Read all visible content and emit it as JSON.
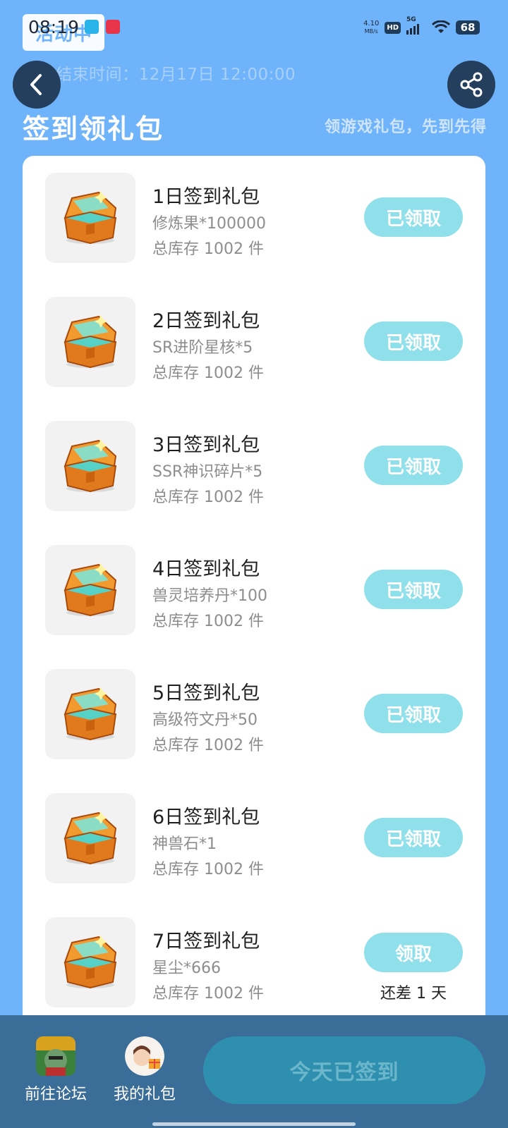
{
  "status_bar": {
    "time": "08:19",
    "net_speed_value": "4.10",
    "net_speed_unit": "MB/s",
    "hd": "HD",
    "signal": "5G",
    "battery": "68"
  },
  "header": {
    "status_chip": "活动中",
    "end_time": "活动结束时间：12月17日 12:00:00",
    "title": "签到领礼包",
    "subtitle": "领游戏礼包，先到先得"
  },
  "gifts": [
    {
      "name": "1日签到礼包",
      "item": "修炼果*100000",
      "stock": "总库存 1002 件",
      "button": "已领取",
      "note": ""
    },
    {
      "name": "2日签到礼包",
      "item": "SR进阶星核*5",
      "stock": "总库存 1002 件",
      "button": "已领取",
      "note": ""
    },
    {
      "name": "3日签到礼包",
      "item": "SSR神识碎片*5",
      "stock": "总库存 1002 件",
      "button": "已领取",
      "note": ""
    },
    {
      "name": "4日签到礼包",
      "item": "兽灵培养丹*100",
      "stock": "总库存 1002 件",
      "button": "已领取",
      "note": ""
    },
    {
      "name": "5日签到礼包",
      "item": "高级符文丹*50",
      "stock": "总库存 1002 件",
      "button": "已领取",
      "note": ""
    },
    {
      "name": "6日签到礼包",
      "item": "神兽石*1",
      "stock": "总库存 1002 件",
      "button": "已领取",
      "note": ""
    },
    {
      "name": "7日签到礼包",
      "item": "星尘*666",
      "stock": "总库存 1002 件",
      "button": "领取",
      "note": "还差 1 天"
    }
  ],
  "bottom_nav": {
    "forum_label": "前往论坛",
    "my_gifts_label": "我的礼包",
    "signin_button": "今天已签到"
  },
  "icons": {
    "back": "chevron-left-icon",
    "share": "share-icon",
    "gift": "treasure-chest-icon"
  },
  "colors": {
    "background": "#6fb3fb",
    "button_claimed": "#8fe0ea",
    "bottom_bar": "#3b6d99",
    "signin_button": "#2f8fae"
  }
}
